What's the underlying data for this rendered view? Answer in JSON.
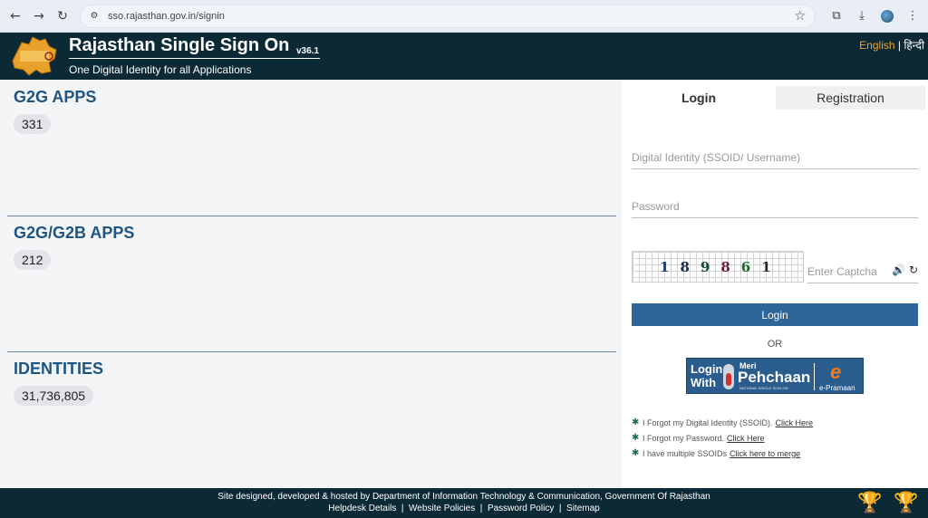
{
  "browser": {
    "url": "sso.rajasthan.gov.in/signin"
  },
  "header": {
    "logo_text": "Rajasthan",
    "title": "Rajasthan Single Sign On",
    "version": "v36.1",
    "subtitle": "One Digital Identity for all Applications",
    "lang_english": "English",
    "lang_sep": " | ",
    "lang_hindi": "हिन्दी"
  },
  "stats": [
    {
      "label": "G2G APPS",
      "value": "331"
    },
    {
      "label": "G2G/G2B APPS",
      "value": "212"
    },
    {
      "label": "IDENTITIES",
      "value": "31,736,805"
    }
  ],
  "login_panel": {
    "tab_login": "Login",
    "tab_registration": "Registration",
    "ssoid_placeholder": "Digital Identity (SSOID/ Username)",
    "password_placeholder": "Password",
    "captcha_digits": [
      {
        "d": "1",
        "color": "#1a3a6b"
      },
      {
        "d": "8",
        "color": "#1a2a4a"
      },
      {
        "d": "9",
        "color": "#0f4a3a"
      },
      {
        "d": "8",
        "color": "#6b1a3a"
      },
      {
        "d": "6",
        "color": "#1a6b2a"
      },
      {
        "d": "1",
        "color": "#2a2a2a"
      }
    ],
    "captcha_placeholder": "Enter Captcha",
    "login_button": "Login",
    "or_text": "OR",
    "pehchaan": {
      "login_with": "Login With",
      "meri": "Meri",
      "brand": "Pehchaan",
      "sub": "NATIONAL SINGLE SIGN-ON",
      "e_logo": "e",
      "e_pramaan": "e-Pramaan"
    },
    "links": [
      {
        "text": "I Forgot my Digital Identity (SSOID).",
        "link": "Click Here"
      },
      {
        "text": "I Forgot my Password.",
        "link": "Click Here"
      },
      {
        "text": "I have multiple SSOIDs",
        "link": "Click here to merge"
      }
    ]
  },
  "footer": {
    "line1": "Site designed, developed & hosted by Department of Information Technology & Communication, Government Of Rajasthan",
    "links": [
      "Helpdesk Details",
      "Website Policies",
      "Password Policy",
      "Sitemap"
    ]
  },
  "colors": {
    "header_bg": "#0c2a36",
    "accent_blue": "#1f5582",
    "button_blue": "#2e6699",
    "lang_orange": "#f0a32b"
  }
}
